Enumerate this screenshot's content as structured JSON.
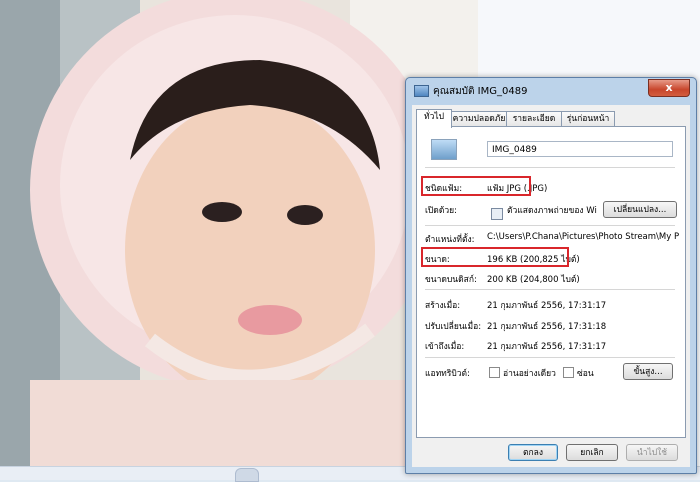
{
  "dialog": {
    "title": "คุณสมบัติ IMG_0489",
    "close_label": "x",
    "tabs": [
      "ทั่วไป",
      "ความปลอดภัย",
      "รายละเอียด",
      "รุ่นก่อนหน้า"
    ],
    "file_name": "IMG_0489",
    "rows": {
      "type_label": "ชนิดแฟ้ม:",
      "type_value": "แฟ้ม JPG (.JPG)",
      "opens_label": "เปิดด้วย:",
      "opens_value": "ตัวแสดงภาพถ่ายของ Wi",
      "change_button": "เปลี่ยนแปลง...",
      "location_label": "ตำแหน่งที่ตั้ง:",
      "location_value": "C:\\Users\\P.Chana\\Pictures\\Photo Stream\\My Photo",
      "size_label": "ขนาด:",
      "size_value": "196 KB (200,825 ไบต์)",
      "disk_label": "ขนาดบนดิสก์:",
      "disk_value": "200 KB (204,800 ไบต์)",
      "created_label": "สร้างเมื่อ:",
      "created_value": "21 กุมภาพันธ์ 2556, 17:31:17",
      "modified_label": "ปรับเปลี่ยนเมื่อ:",
      "modified_value": "21 กุมภาพันธ์ 2556, 17:31:18",
      "accessed_label": "เข้าถึงเมื่อ:",
      "accessed_value": "21 กุมภาพันธ์ 2556, 17:31:17",
      "attributes_label": "แอททริบิวต์:",
      "readonly_label": "อ่านอย่างเดียว",
      "hidden_label": "ซ่อน",
      "advanced_button": "ขั้นสูง..."
    },
    "buttons": {
      "ok": "ตกลง",
      "cancel": "ยกเลิก",
      "apply": "นำไปใช้"
    },
    "highlight_color": "#d9262b"
  }
}
